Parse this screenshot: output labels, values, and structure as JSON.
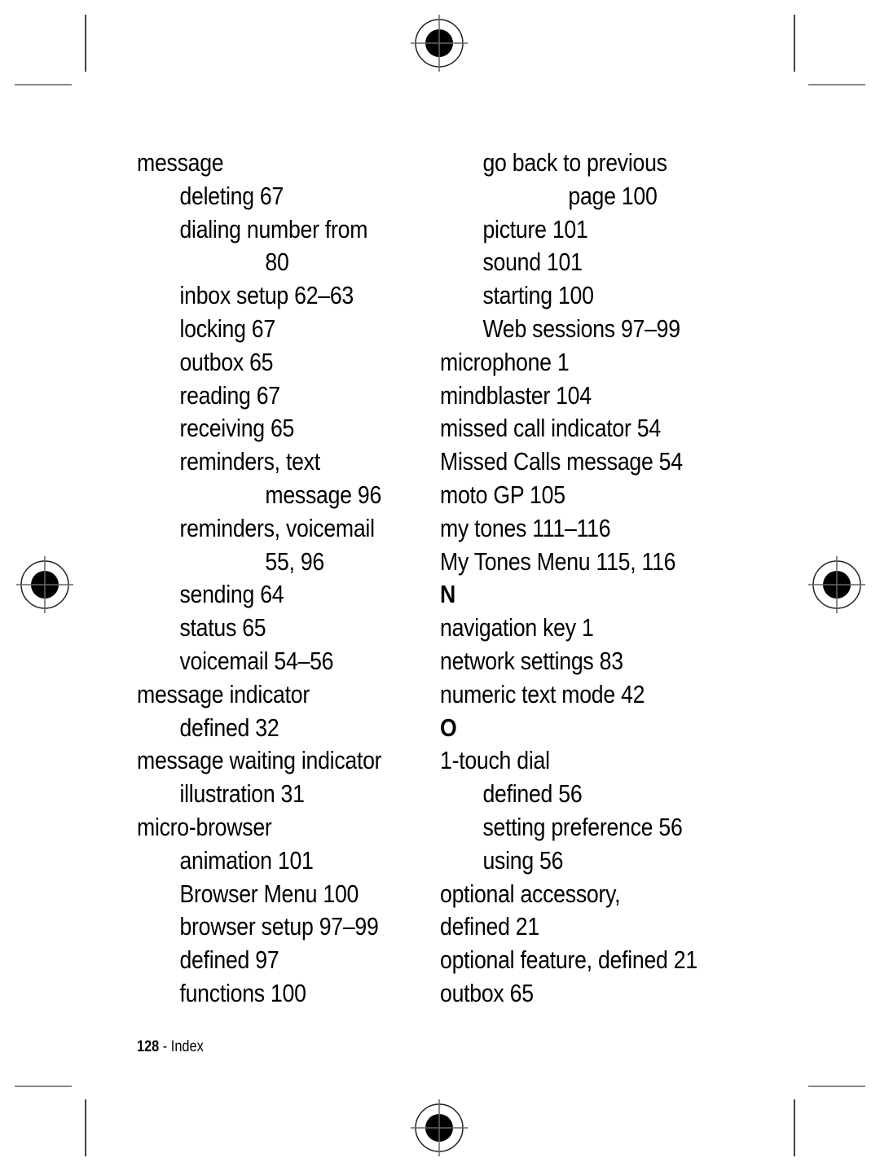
{
  "left_column": [
    {
      "text": "message",
      "level": 0
    },
    {
      "text": "deleting 67",
      "level": 1
    },
    {
      "text": "dialing number from",
      "level": 1
    },
    {
      "text": "80",
      "level": 2
    },
    {
      "text": "inbox setup 62–63",
      "level": 1
    },
    {
      "text": "locking 67",
      "level": 1
    },
    {
      "text": "outbox 65",
      "level": 1
    },
    {
      "text": "reading 67",
      "level": 1
    },
    {
      "text": "receiving 65",
      "level": 1
    },
    {
      "text": "reminders, text",
      "level": 1
    },
    {
      "text": "message 96",
      "level": 2
    },
    {
      "text": "reminders, voicemail",
      "level": 1
    },
    {
      "text": "55, 96",
      "level": 2
    },
    {
      "text": "sending 64",
      "level": 1
    },
    {
      "text": "status 65",
      "level": 1
    },
    {
      "text": "voicemail 54–56",
      "level": 1
    },
    {
      "text": "message indicator",
      "level": 0
    },
    {
      "text": "defined 32",
      "level": 1
    },
    {
      "text": "message waiting indicator",
      "level": 0
    },
    {
      "text": "illustration 31",
      "level": 1
    },
    {
      "text": "micro-browser",
      "level": 0
    },
    {
      "text": "animation 101",
      "level": 1
    },
    {
      "text": "Browser Menu 100",
      "level": 1
    },
    {
      "text": "browser setup 97–99",
      "level": 1
    },
    {
      "text": "defined 97",
      "level": 1
    },
    {
      "text": "functions 100",
      "level": 1
    }
  ],
  "right_column": [
    {
      "text": "go back to previous",
      "level": 1
    },
    {
      "text": "page 100",
      "level": 2
    },
    {
      "text": "picture 101",
      "level": 1
    },
    {
      "text": "sound 101",
      "level": 1
    },
    {
      "text": "starting 100",
      "level": 1
    },
    {
      "text": "Web sessions 97–99",
      "level": 1
    },
    {
      "text": "microphone 1",
      "level": 0
    },
    {
      "text": "mindblaster 104",
      "level": 0
    },
    {
      "text": "missed call indicator 54",
      "level": 0
    },
    {
      "text": "Missed Calls message 54",
      "level": 0
    },
    {
      "text": "moto GP 105",
      "level": 0
    },
    {
      "text": "my tones 111–116",
      "level": 0
    },
    {
      "text": "My Tones Menu 115, 116",
      "level": 0
    },
    {
      "text": "N",
      "level": 0,
      "heading": true
    },
    {
      "text": "navigation key 1",
      "level": 0
    },
    {
      "text": "network settings 83",
      "level": 0
    },
    {
      "text": "numeric text mode 42",
      "level": 0
    },
    {
      "text": "O",
      "level": 0,
      "heading": true
    },
    {
      "text": "1-touch dial",
      "level": 0
    },
    {
      "text": "defined 56",
      "level": 1
    },
    {
      "text": "setting preference 56",
      "level": 1
    },
    {
      "text": "using 56",
      "level": 1
    },
    {
      "text": "optional accessory,",
      "level": 0
    },
    {
      "text": "defined 21",
      "level": 0
    },
    {
      "text": "optional feature, defined 21",
      "level": 0
    },
    {
      "text": "outbox 65",
      "level": 0
    }
  ],
  "footer": {
    "page_number": "128",
    "separator": " - ",
    "section": "Index"
  },
  "icons": {
    "registration_mark": "crosshair-target-icon"
  }
}
